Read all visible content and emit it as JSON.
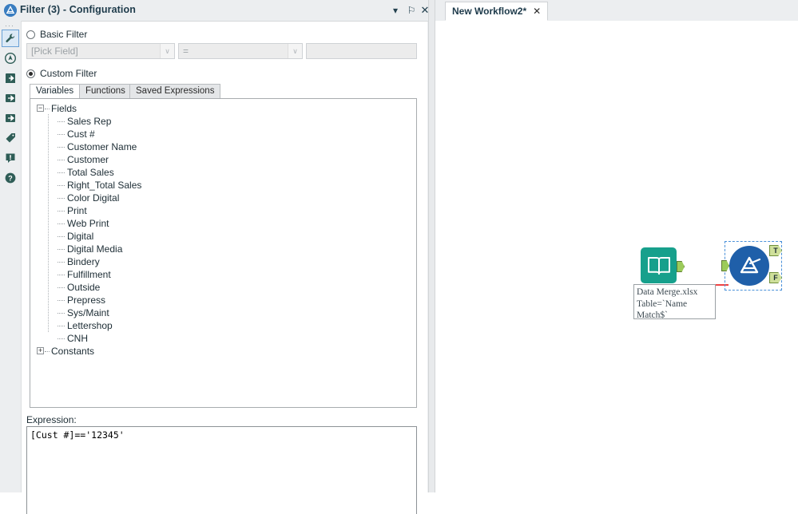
{
  "window": {
    "title": "Filter (3) - Configuration",
    "logo_icon": "alteryx-logo-icon",
    "dropdown_icon": "chevron-down-icon",
    "pin_icon": "pin-icon",
    "close_icon": "close-icon",
    "dropdown_glyph": "▾",
    "pin_glyph": "⚐",
    "close_glyph": "✕"
  },
  "rail": {
    "dots": "···",
    "items": [
      {
        "name": "wrench-icon",
        "title": "Configuration"
      },
      {
        "name": "compass-icon",
        "title": "Annotation"
      },
      {
        "name": "input-box-icon",
        "title": "Input"
      },
      {
        "name": "output-arrow-icon",
        "title": "Output 1"
      },
      {
        "name": "output-arrow2-icon",
        "title": "Output 2"
      },
      {
        "name": "tag-icon",
        "title": "Tag"
      },
      {
        "name": "alert-icon",
        "title": "Messages"
      },
      {
        "name": "help-icon",
        "title": "Help"
      }
    ]
  },
  "filter_mode": {
    "basic_label": "Basic Filter",
    "basic_selected": false,
    "custom_label": "Custom Filter",
    "custom_selected": true
  },
  "basic_filter": {
    "field_value": "[Pick Field]",
    "operator_value": "=",
    "value_value": "",
    "caret_glyph": "∨",
    "enabled": false
  },
  "tabs": [
    {
      "label": "Variables",
      "active": true
    },
    {
      "label": "Functions",
      "active": false
    },
    {
      "label": "Saved Expressions",
      "active": false
    }
  ],
  "tree": {
    "fields_label": "Fields",
    "fields_expander": "−",
    "fields": [
      "Sales Rep",
      "Cust #",
      "Customer Name",
      "Customer",
      "Total Sales",
      "Right_Total Sales",
      "Color Digital",
      "Print",
      "Web Print",
      "Digital",
      "Digital Media",
      "Bindery",
      "Fulfillment",
      "Outside",
      "Prepress",
      "Sys/Maint",
      "Lettershop",
      "CNH"
    ],
    "constants_label": "Constants",
    "constants_expander": "+"
  },
  "expression": {
    "label": "Expression:",
    "value": "[Cust #]=='12345'"
  },
  "workflow": {
    "tab_label": "New Workflow2*",
    "tab_close_glyph": "✕",
    "input_node": {
      "name": "input-data-node",
      "icon": "open-book-icon",
      "color": "#17a08c"
    },
    "filter_node": {
      "name": "filter-node",
      "icon": "funnel-icon",
      "color": "#1f5fa9",
      "selected": true,
      "outputs": [
        {
          "label": "T",
          "name": "true-output-port"
        },
        {
          "label": "F",
          "name": "false-output-port"
        }
      ]
    },
    "connection_color": "#ef4444",
    "annotation": "Data Merge.xlsx\nTable=`Name Match$`"
  }
}
